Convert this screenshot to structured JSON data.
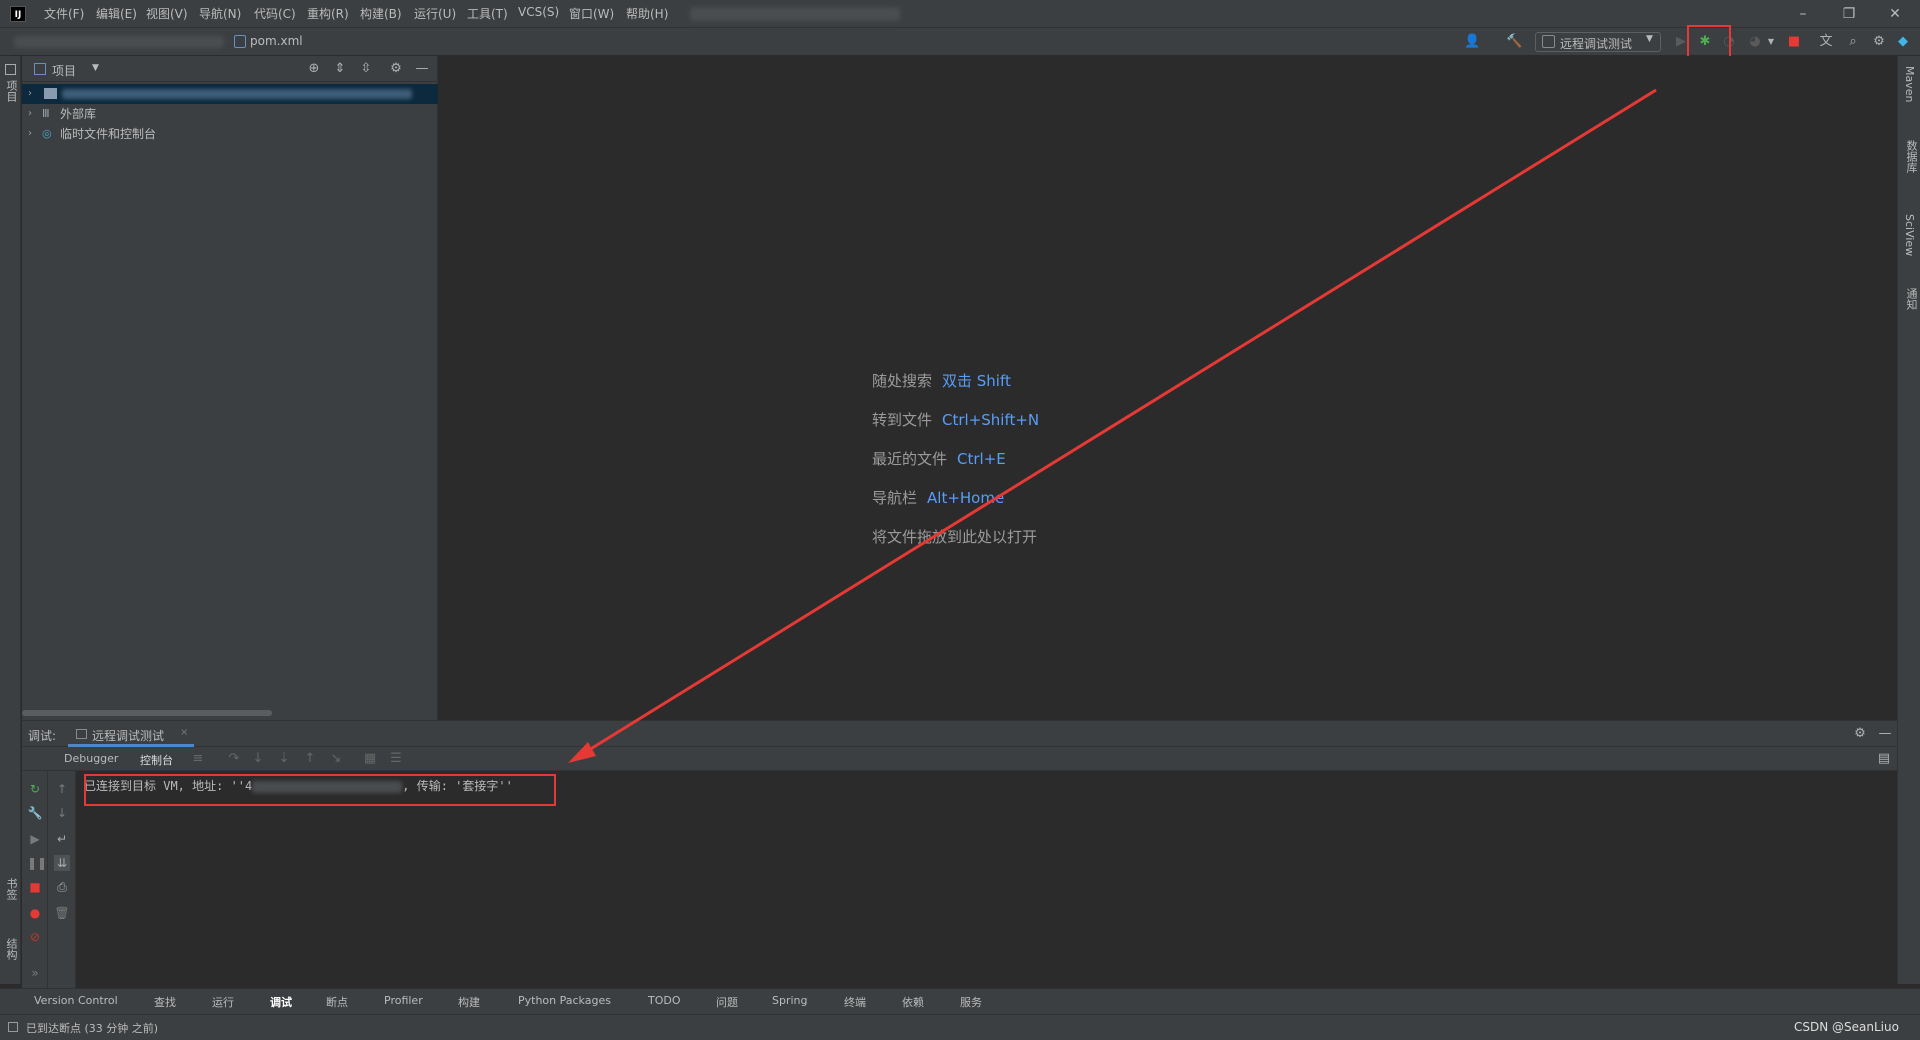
{
  "menu": [
    "文件(F)",
    "编辑(E)",
    "视图(V)",
    "导航(N)",
    "代码(C)",
    "重构(R)",
    "构建(B)",
    "运行(U)",
    "工具(T)",
    "VCS(S)",
    "窗口(W)",
    "帮助(H)"
  ],
  "window_controls": [
    "–",
    "❐",
    "✕"
  ],
  "navbar": {
    "file": "pom.xml",
    "run_config": "远程调试测试"
  },
  "project_panel": {
    "title": "项目",
    "items": [
      {
        "label": "外部库",
        "icon": "library-icon"
      },
      {
        "label": "临时文件和控制台",
        "icon": "scratch-icon"
      }
    ]
  },
  "left_stripe": {
    "project": "项目",
    "bookmarks": "书签",
    "structure": "结构"
  },
  "right_stripe": [
    "Maven",
    "数据库",
    "SciView",
    "通知"
  ],
  "editor_hints": [
    {
      "label": "随处搜索",
      "key": "双击 Shift"
    },
    {
      "label": "转到文件",
      "key": "Ctrl+Shift+N"
    },
    {
      "label": "最近的文件",
      "key": "Ctrl+E"
    },
    {
      "label": "导航栏",
      "key": "Alt+Home"
    },
    {
      "label": "将文件拖放到此处以打开",
      "key": ""
    }
  ],
  "debug": {
    "label": "调试:",
    "session_tab": "远程调试测试",
    "subtabs": [
      "Debugger",
      "控制台"
    ],
    "console_prefix": "已连接到目标 VM, 地址: ''4",
    "console_suffix": ", 传输: '套接字''"
  },
  "bottom_tabs": [
    "Version Control",
    "查找",
    "运行",
    "调试",
    "断点",
    "Profiler",
    "构建",
    "Python Packages",
    "TODO",
    "问题",
    "Spring",
    "终端",
    "依赖",
    "服务"
  ],
  "status": {
    "message": "已到达断点 (33 分钟 之前)",
    "watermark": "CSDN @SeanLiuo"
  },
  "colors": {
    "accent_blue": "#589df6",
    "highlight_red": "#e53935",
    "debug_green": "#4caf50"
  }
}
